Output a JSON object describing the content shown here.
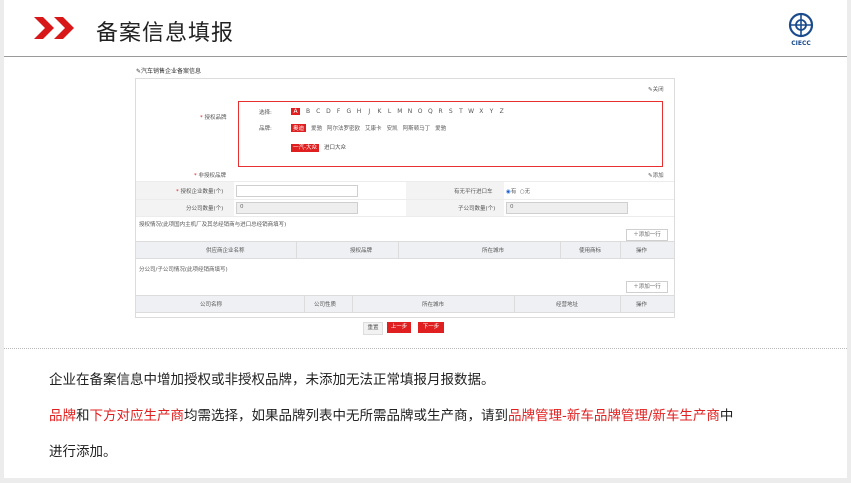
{
  "header": {
    "title": "备案信息填报",
    "logo_text": "CIECC"
  },
  "form": {
    "section_title": "汽车销售企业备案信息",
    "close_label": "关闭",
    "auth_brand_label": "授权品牌",
    "select_label": "选择:",
    "letters": [
      "A",
      "B",
      "C",
      "D",
      "F",
      "G",
      "H",
      "J",
      "K",
      "L",
      "M",
      "N",
      "O",
      "Q",
      "R",
      "S",
      "T",
      "W",
      "X",
      "Y",
      "Z"
    ],
    "selected_letter": "A",
    "brand_label": "品牌:",
    "brands": [
      {
        "name": "奥迪",
        "selected": true
      },
      {
        "name": "爱驰",
        "selected": false
      },
      {
        "name": "阿尔法罗密欧",
        "selected": false
      },
      {
        "name": "艾康卡",
        "selected": false
      },
      {
        "name": "安凯",
        "selected": false
      },
      {
        "name": "阿斯顿马丁",
        "selected": false
      },
      {
        "name": "爱驰",
        "selected": false
      }
    ],
    "makers": [
      {
        "name": "一汽-大众",
        "selected": true
      },
      {
        "name": "进口大众",
        "selected": false
      }
    ],
    "non_auth_brand_label": "非授权品牌",
    "add_label": "添加",
    "auth_count_label": "授权企业数量(个)",
    "import_label": "有无平行进口车",
    "import_yes": "有",
    "import_no": "无",
    "branch_count_label": "分公司数量(个)",
    "branch_count_value": "0",
    "sub_count_label": "子公司数量(个)",
    "sub_count_value": "0",
    "auth_section_title": "授权情况(此项国内主机厂及其总经销商与进口总经销商填写)",
    "add_row_label": "添加一行",
    "auth_table_headers": [
      "供应商企业名称",
      "授权品牌",
      "所在城市",
      "使用商标",
      "操作"
    ],
    "branch_section_title": "分公司/子公司情况(此项经销商填写)",
    "branch_table_headers": [
      "公司名称",
      "公司性质",
      "所在城市",
      "经营地址",
      "操作"
    ],
    "buttons": {
      "reset": "重置",
      "prev": "上一步",
      "next": "下一步"
    }
  },
  "notes": {
    "line1": "企业在备案信息中增加授权或非授权品牌，未添加无法正常填报月报数据。",
    "line2": [
      {
        "text": "品牌",
        "hl": true
      },
      {
        "text": "和",
        "hl": false
      },
      {
        "text": "下方对应生产商",
        "hl": true
      },
      {
        "text": "均需选择，如果品牌列表中无所需品牌或生产商，请到",
        "hl": false
      },
      {
        "text": "品牌管理-新车品牌管理/新车生产商",
        "hl": true
      },
      {
        "text": "中",
        "hl": false
      }
    ],
    "line3": "进行添加。"
  },
  "colors": {
    "accent": "#e02020",
    "title_chevron": "#d81818",
    "logo_blue": "#1a4b8c"
  }
}
